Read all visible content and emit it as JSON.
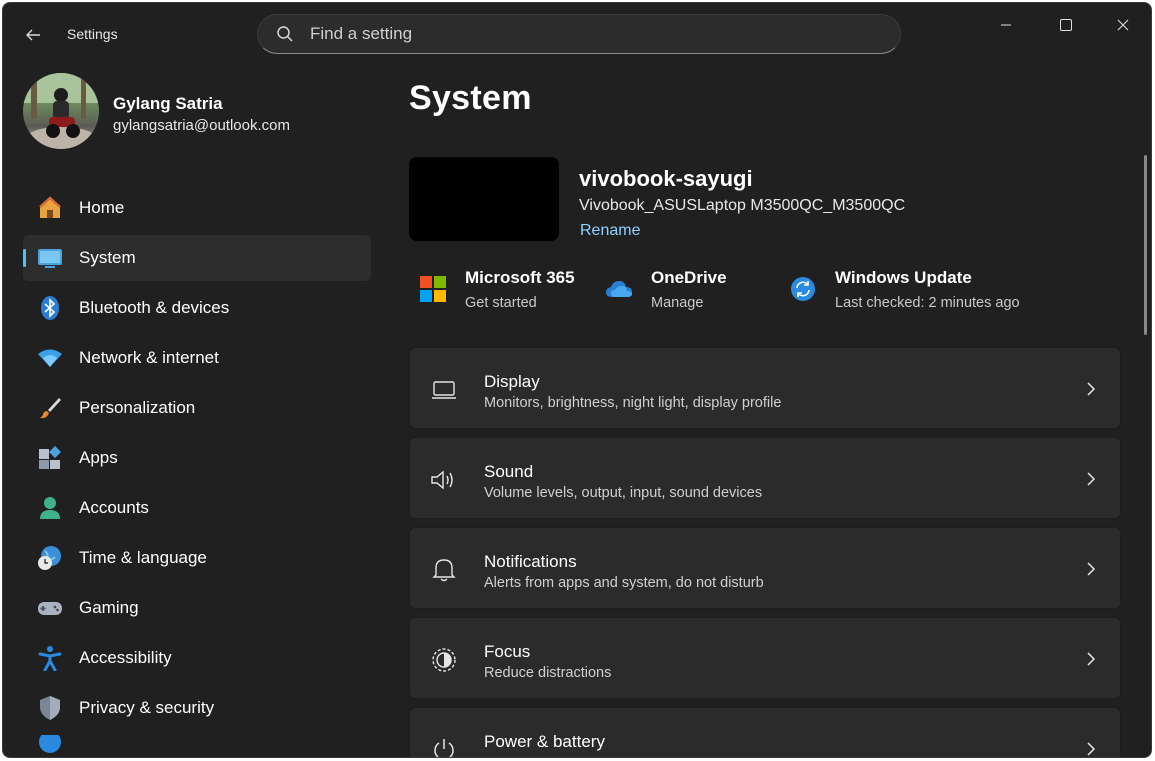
{
  "titlebar": {
    "app_title": "Settings",
    "search_placeholder": "Find a setting"
  },
  "profile": {
    "name": "Gylang Satria",
    "email": "gylangsatria@outlook.com"
  },
  "sidebar": {
    "items": [
      {
        "label": "Home",
        "icon": "home-icon",
        "active": false
      },
      {
        "label": "System",
        "icon": "system-icon",
        "active": true
      },
      {
        "label": "Bluetooth & devices",
        "icon": "bluetooth-icon",
        "active": false
      },
      {
        "label": "Network & internet",
        "icon": "wifi-icon",
        "active": false
      },
      {
        "label": "Personalization",
        "icon": "brush-icon",
        "active": false
      },
      {
        "label": "Apps",
        "icon": "apps-icon",
        "active": false
      },
      {
        "label": "Accounts",
        "icon": "person-icon",
        "active": false
      },
      {
        "label": "Time & language",
        "icon": "globe-clock-icon",
        "active": false
      },
      {
        "label": "Gaming",
        "icon": "gamepad-icon",
        "active": false
      },
      {
        "label": "Accessibility",
        "icon": "accessibility-icon",
        "active": false
      },
      {
        "label": "Privacy & security",
        "icon": "shield-icon",
        "active": false
      }
    ]
  },
  "main": {
    "page_title": "System",
    "device": {
      "name": "vivobook-sayugi",
      "model": "Vivobook_ASUSLaptop M3500QC_M3500QC",
      "rename_label": "Rename"
    },
    "quick_links": [
      {
        "title": "Microsoft 365",
        "subtitle": "Get started",
        "icon": "microsoft-logo-icon"
      },
      {
        "title": "OneDrive",
        "subtitle": "Manage",
        "icon": "onedrive-cloud-icon"
      },
      {
        "title": "Windows Update",
        "subtitle": "Last checked: 2 minutes ago",
        "icon": "windows-update-icon"
      }
    ],
    "cards": [
      {
        "title": "Display",
        "subtitle": "Monitors, brightness, night light, display profile",
        "icon": "laptop-icon"
      },
      {
        "title": "Sound",
        "subtitle": "Volume levels, output, input, sound devices",
        "icon": "speaker-icon"
      },
      {
        "title": "Notifications",
        "subtitle": "Alerts from apps and system, do not disturb",
        "icon": "bell-icon"
      },
      {
        "title": "Focus",
        "subtitle": "Reduce distractions",
        "icon": "focus-icon"
      },
      {
        "title": "Power & battery",
        "subtitle": "",
        "icon": "power-icon"
      }
    ]
  },
  "colors": {
    "background": "#202020",
    "card": "#2b2b2b",
    "accent": "#4cc2ff",
    "link": "#8ed1ff"
  }
}
